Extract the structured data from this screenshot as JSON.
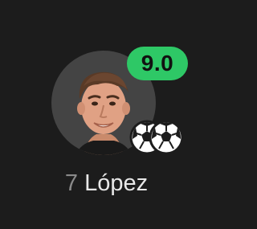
{
  "player": {
    "rating": "9.0",
    "shirt_number": "7",
    "name": "López",
    "goals_count": 2
  },
  "colors": {
    "background": "#1c1c1c",
    "rating_badge": "#2ec866",
    "avatar_bg": "#444444",
    "number_text": "#8a8a8a",
    "name_text": "#e8e8e8"
  },
  "icons": {
    "goal": "soccer-ball-icon",
    "avatar": "player-photo"
  }
}
